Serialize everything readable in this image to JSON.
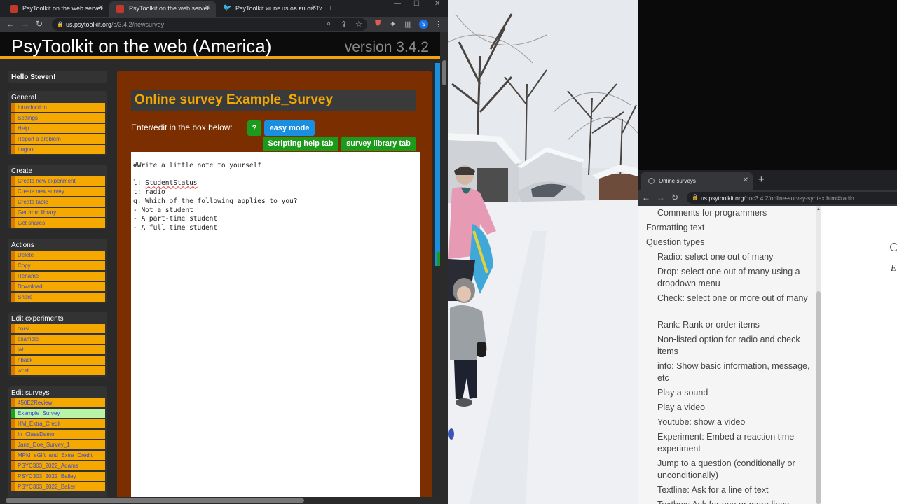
{
  "left_browser": {
    "tabs": [
      {
        "title": "PsyToolkit on the web server",
        "active": false
      },
      {
        "title": "PsyToolkit on the web server",
        "active": true
      },
      {
        "title": "PsyToolkit ᴎʟ ᴅᴇ ᴜs ɢʙ ᴇᴜ on Tw",
        "active": false
      }
    ],
    "url_host": "us.psytoolkit.org",
    "url_path": "/c/3.4.2/newsurvey",
    "avatar_letter": "S",
    "site_title": "PsyToolkit on the web (America)",
    "site_version": "version 3.4.2",
    "greeting": "Hello Steven!",
    "sidebar": {
      "general": {
        "title": "General",
        "items": [
          "Introduction",
          "Settings",
          "Help",
          "Report a problem",
          "Logout"
        ]
      },
      "create": {
        "title": "Create",
        "items": [
          "Create new experiment",
          "Create new survey",
          "Create table",
          "Get from library",
          "Get shares"
        ]
      },
      "actions": {
        "title": "Actions",
        "items": [
          "Delete",
          "Copy",
          "Rename",
          "Download",
          "Share"
        ]
      },
      "edit_experiments": {
        "title": "Edit experiments",
        "items": [
          "corsi",
          "example",
          "iat",
          "nback",
          "wcst"
        ]
      },
      "edit_surveys": {
        "title": "Edit surveys",
        "items": [
          "450E2Review",
          "Example_Survey",
          "HM_Extra_Credit",
          "In_ClassDemo",
          "Jane_Doe_Survey_1",
          "MPM_eGift_and_Extra_Credit",
          "PSYC303_2022_Adams",
          "PSYC303_2022_Bailey",
          "PSYC303_2022_Baker"
        ],
        "selected_index": 1
      }
    },
    "survey_heading": "Online survey Example_Survey",
    "edit_label": "Enter/edit in the box below:",
    "help_button": "?",
    "easy_mode_button": "easy mode",
    "scripting_tab": "Scripting help tab",
    "library_tab": "survey library tab",
    "editor_lines": [
      "#Write a little note to yourself",
      "",
      "l: StudentStatus",
      "t: radio",
      "q: Which of the following applies to you?",
      "- Not a student",
      "- A part-time student",
      "- A full time student"
    ]
  },
  "right_browser": {
    "tab_title": "Online surveys",
    "url_host": "us.psytoolkit.org",
    "url_path": "/doc3.4.2/online-survey-syntax.html#radio",
    "toc": [
      {
        "label": "Comments for programmers",
        "level": 2
      },
      {
        "label": "Formatting text",
        "level": 1
      },
      {
        "label": "Question types",
        "level": 1
      },
      {
        "label": "Radio: select one out of many",
        "level": 2
      },
      {
        "label": "Drop: select one out of many using a dropdown menu",
        "level": 2
      },
      {
        "label": "Check: select one or more out of many",
        "level": 2
      },
      {
        "label": "Rank: Rank or order items",
        "level": 2
      },
      {
        "label": "Non-listed option for radio and check items",
        "level": 2
      },
      {
        "label": "info: Show basic information, message, etc",
        "level": 2
      },
      {
        "label": "Play a sound",
        "level": 2
      },
      {
        "label": "Play a video",
        "level": 2
      },
      {
        "label": "Youtube: show a video",
        "level": 2
      },
      {
        "label": "Experiment: Embed a reaction time experiment",
        "level": 2
      },
      {
        "label": "Jump to a question (conditionally or unconditionally)",
        "level": 2
      },
      {
        "label": "Textline: Ask for a line of text",
        "level": 2
      },
      {
        "label": "Textbox: Ask for one or more lines",
        "level": 2
      }
    ],
    "doc_partial_letter": "E"
  },
  "colors": {
    "accent_orange": "#f5a900",
    "survey_bg": "#7b2f00",
    "green_button": "#1c9a1c",
    "blue_button": "#1a8fe0"
  }
}
